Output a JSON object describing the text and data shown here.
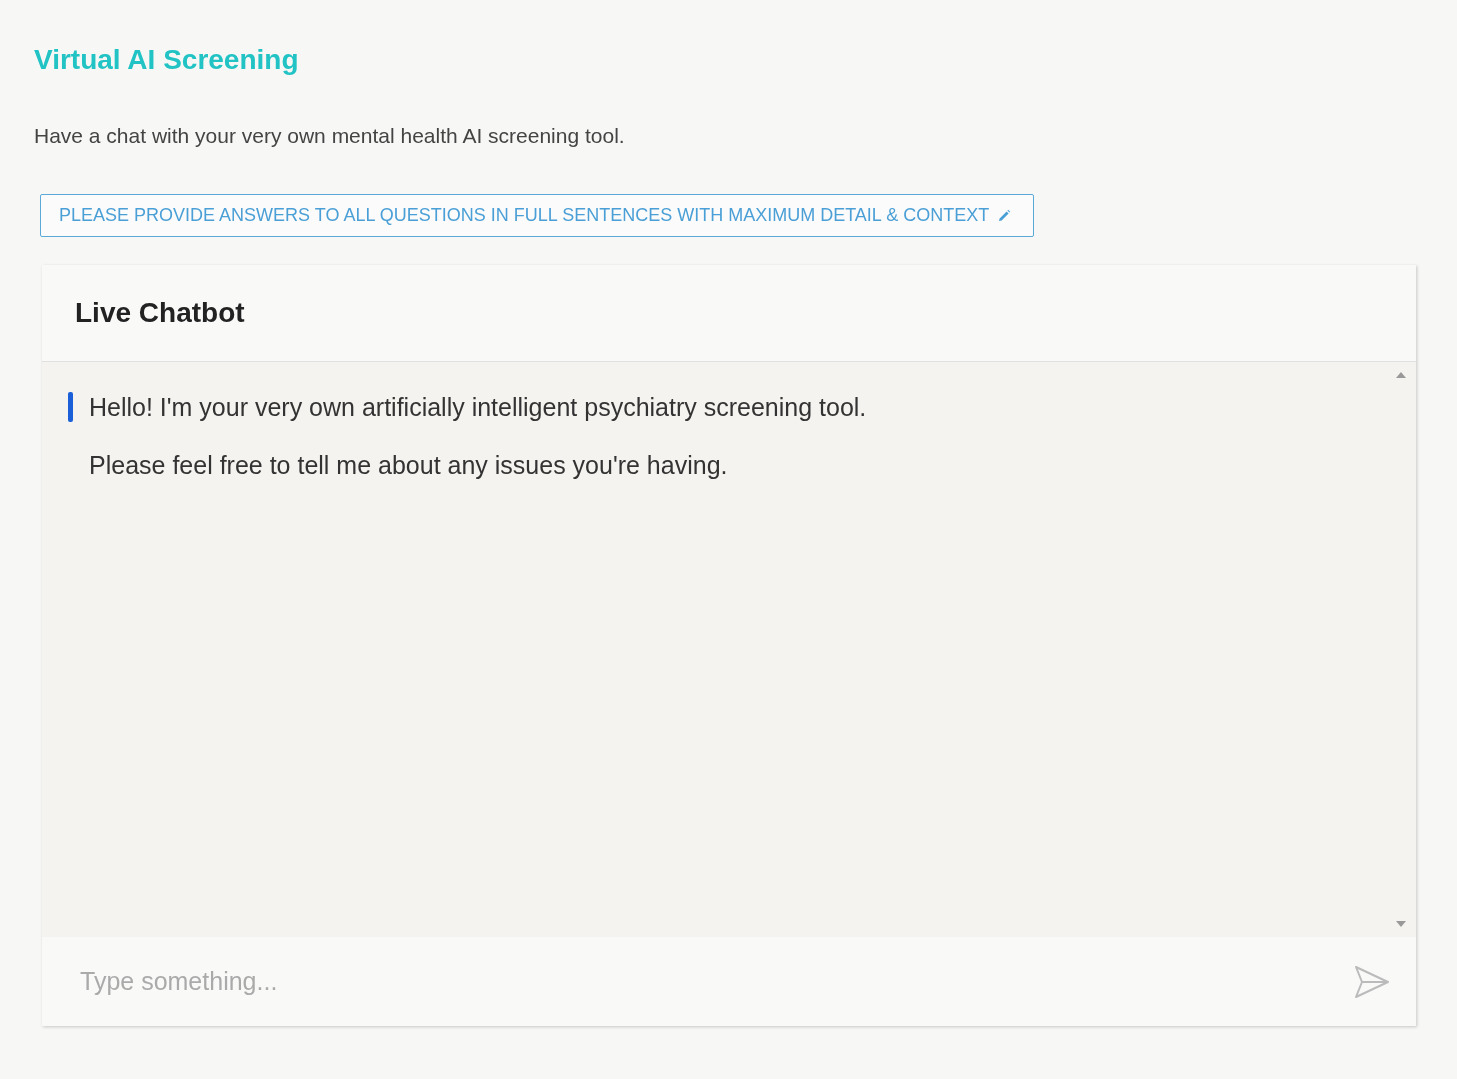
{
  "title": "Virtual AI Screening",
  "subtitle": "Have a chat with your very own mental health AI screening tool.",
  "instruction_button": {
    "label": "PLEASE PROVIDE ANSWERS TO ALL QUESTIONS IN FULL SENTENCES WITH MAXIMUM DETAIL & CONTEXT"
  },
  "chat": {
    "title": "Live Chatbot",
    "messages": [
      {
        "text": "Hello! I'm your very own artificially intelligent psychiatry screening tool.",
        "highlighted": true
      },
      {
        "text": "Please feel free to tell me about any issues you're having.",
        "highlighted": false
      }
    ],
    "input": {
      "placeholder": "Type something..."
    }
  }
}
